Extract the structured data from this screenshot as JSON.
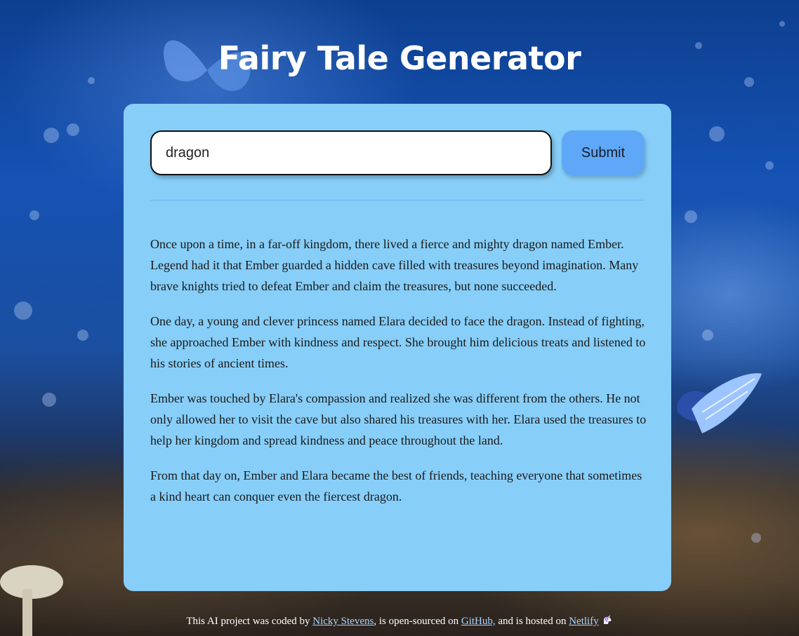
{
  "page": {
    "title": "Fairy Tale Generator"
  },
  "search": {
    "value": "dragon",
    "submit_label": "Submit"
  },
  "story": {
    "paragraphs": [
      "Once upon a time, in a far-off kingdom, there lived a fierce and mighty dragon named Ember. Legend had it that Ember guarded a hidden cave filled with treasures beyond imagination. Many brave knights tried to defeat Ember and claim the treasures, but none succeeded.",
      "One day, a young and clever princess named Elara decided to face the dragon. Instead of fighting, she approached Ember with kindness and respect. She brought him delicious treats and listened to his stories of ancient times.",
      "Ember was touched by Elara's compassion and realized she was different from the others. He not only allowed her to visit the cave but also shared his treasures with her. Elara used the treasures to help her kingdom and spread kindness and peace throughout the land.",
      "From that day on, Ember and Elara became the best of friends, teaching everyone that sometimes a kind heart can conquer even the fiercest dragon."
    ]
  },
  "footer": {
    "text_1": "This AI project was coded by ",
    "author_link": "Nicky Stevens",
    "text_2": ", is open-sourced on ",
    "github_link": "GitHub,",
    "text_3": " and is hosted on ",
    "netlify_link": "Netlify",
    "icon": "unicorn-icon"
  },
  "colors": {
    "card": "#87cef8",
    "button": "#5ea8f7",
    "link": "#a9d6ff"
  }
}
